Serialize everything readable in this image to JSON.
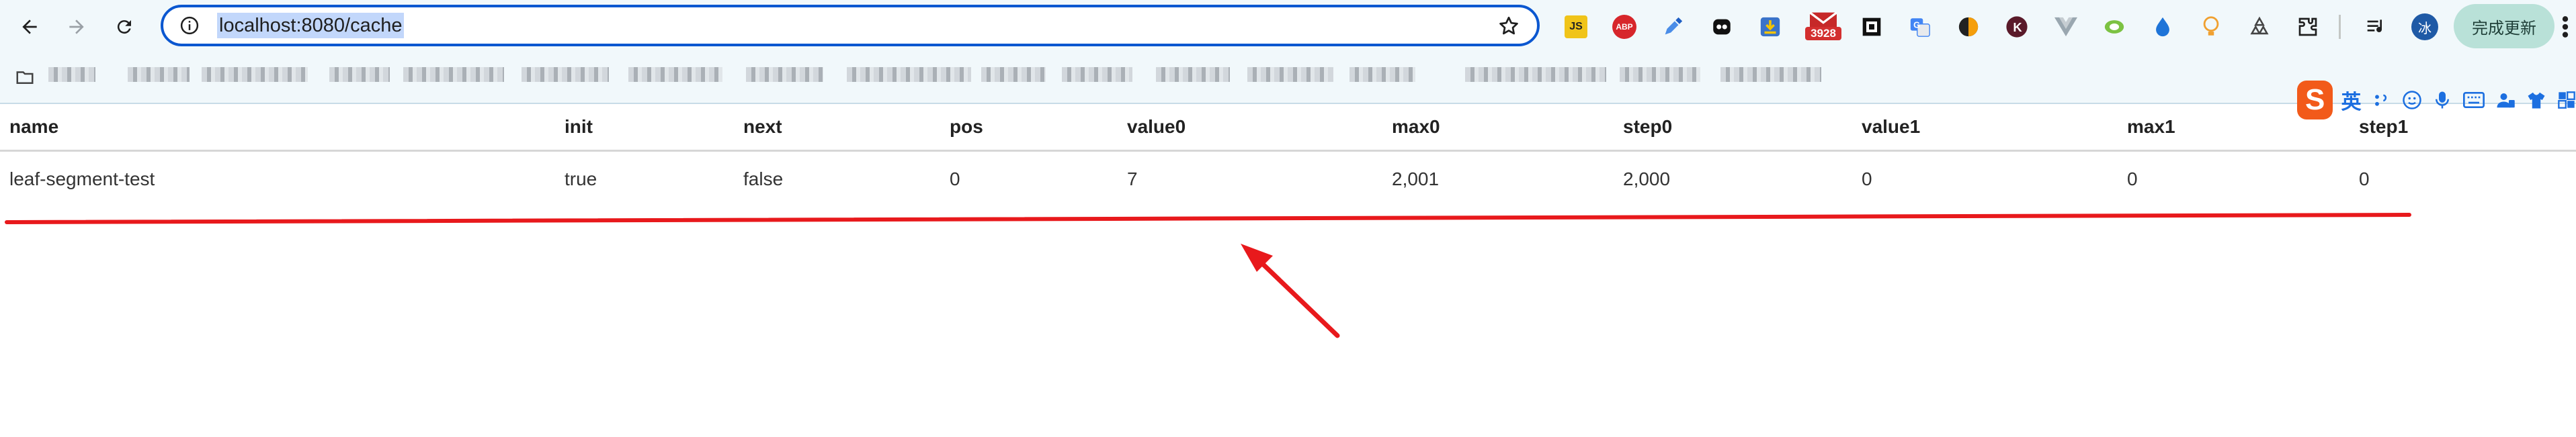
{
  "browser": {
    "url": "localhost:8080/cache",
    "update_button": "完成更新",
    "profile_initial": "冰",
    "extensions": [
      {
        "name": "js-extension-icon",
        "label": "JS"
      },
      {
        "name": "adblock-icon",
        "label": "ABP"
      },
      {
        "name": "eyedropper-icon",
        "label": ""
      },
      {
        "name": "ghost-icon",
        "label": ""
      },
      {
        "name": "download-icon",
        "label": ""
      },
      {
        "name": "mail-counter-icon",
        "label": "3928"
      },
      {
        "name": "qr-icon",
        "label": ""
      },
      {
        "name": "translate-icon",
        "label": ""
      },
      {
        "name": "theme-icon",
        "label": ""
      },
      {
        "name": "k-icon",
        "label": ""
      },
      {
        "name": "vue-icon",
        "label": ""
      },
      {
        "name": "colorzilla-icon",
        "label": ""
      },
      {
        "name": "drop-icon",
        "label": ""
      },
      {
        "name": "bulb-icon",
        "label": ""
      },
      {
        "name": "recycle-icon",
        "label": ""
      },
      {
        "name": "puzzle-icon",
        "label": ""
      },
      {
        "name": "media-queue-icon",
        "label": ""
      }
    ]
  },
  "ime": {
    "logo": "S",
    "language": "英"
  },
  "table": {
    "columns": [
      "name",
      "init",
      "next",
      "pos",
      "value0",
      "max0",
      "step0",
      "value1",
      "max1",
      "step1"
    ],
    "rows": [
      [
        "leaf-segment-test",
        "true",
        "false",
        "0",
        "7",
        "2,001",
        "2,000",
        "0",
        "0",
        "0"
      ]
    ]
  },
  "colors": {
    "accent": "#0b57d0",
    "annotation": "#e8191c",
    "toolbar_bg": "#f1f8fb"
  }
}
